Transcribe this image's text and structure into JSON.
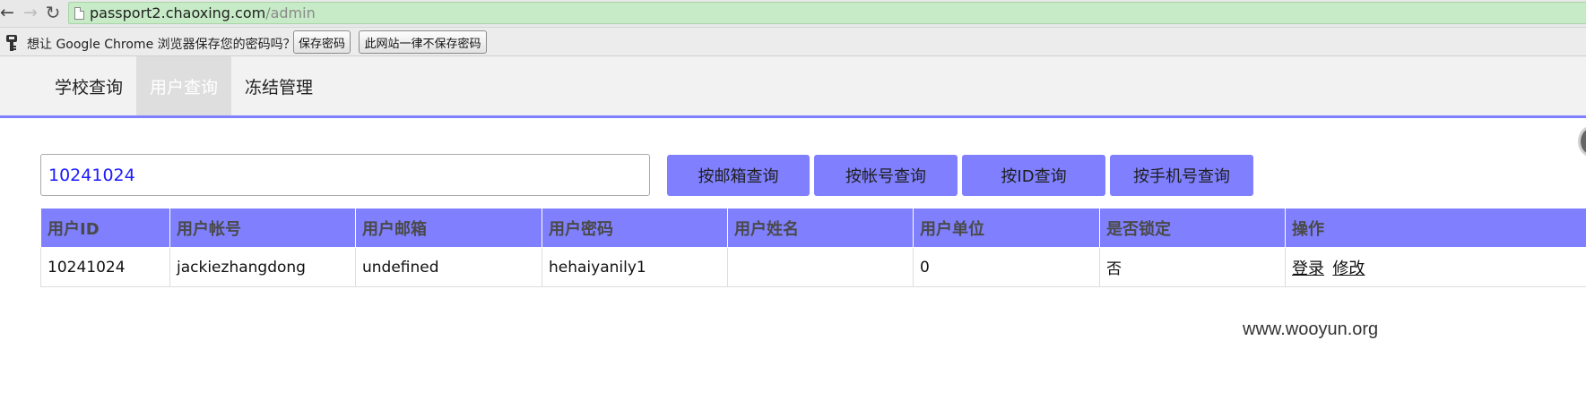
{
  "browser": {
    "url_host": "passport2.chaoxing.com",
    "url_path": "/admin",
    "nav_icons": {
      "back": "arrow-left-icon",
      "forward": "arrow-right-icon",
      "reload": "reload-icon",
      "page": "page-icon"
    }
  },
  "infobar": {
    "icon": "key-icon",
    "message": "想让 Google Chrome 浏览器保存您的密码吗？",
    "save_label": "保存密码",
    "never_label": "此网站一律不保存密码"
  },
  "nav": {
    "tabs": [
      {
        "label": "学校查询",
        "active": false
      },
      {
        "label": "用户查询",
        "active": true
      },
      {
        "label": "冻结管理",
        "active": false
      }
    ]
  },
  "search": {
    "value": "10241024",
    "buttons": [
      "按邮箱查询",
      "按帐号查询",
      "按ID查询",
      "按手机号查询"
    ]
  },
  "table": {
    "headers": [
      "用户ID",
      "用户帐号",
      "用户邮箱",
      "用户密码",
      "用户姓名",
      "用户单位",
      "是否锁定",
      "操作"
    ],
    "rows": [
      {
        "id": "10241024",
        "account": "jackiezhangdong",
        "email": "undefined",
        "password": "hehaiyanily1",
        "name": "",
        "org": "0",
        "locked": "否",
        "actions": [
          "登录",
          "修改"
        ]
      }
    ]
  },
  "watermark": "www.wooyun.org",
  "colors": {
    "accent": "#8080ff",
    "omnibox_bg": "#c6ebc6",
    "input_text": "#1a1aff"
  }
}
